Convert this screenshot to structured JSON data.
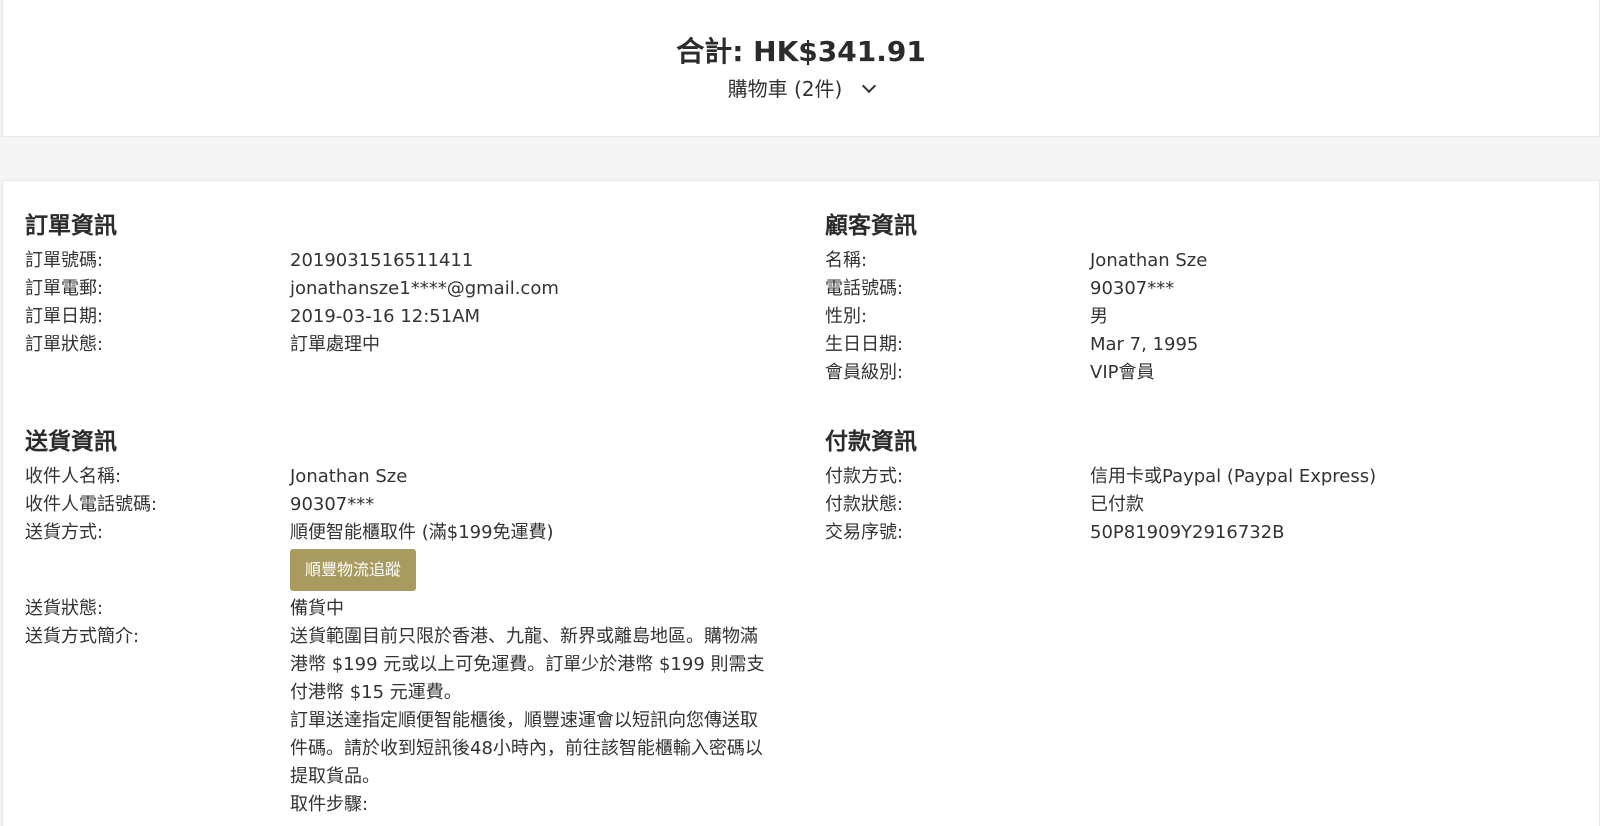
{
  "summary": {
    "total_text": "合計: HK$341.91",
    "cart_label": "購物車 (2件)",
    "toggle_icon": "chevron-down-icon"
  },
  "order_info": {
    "title": "訂單資訊",
    "rows": [
      {
        "label": "訂單號碼:",
        "value": "2019031516511411"
      },
      {
        "label": "訂單電郵:",
        "value": "jonathansze1****@gmail.com"
      },
      {
        "label": "訂單日期:",
        "value": "2019-03-16 12:51AM"
      },
      {
        "label": "訂單狀態:",
        "value": "訂單處理中"
      }
    ]
  },
  "customer_info": {
    "title": "顧客資訊",
    "rows": [
      {
        "label": "名稱:",
        "value": "Jonathan Sze"
      },
      {
        "label": "電話號碼:",
        "value": "90307***"
      },
      {
        "label": "性別:",
        "value": "男"
      },
      {
        "label": "生日日期:",
        "value": "Mar 7, 1995"
      },
      {
        "label": "會員級別:",
        "value": "VIP會員"
      }
    ]
  },
  "shipping_info": {
    "title": "送貨資訊",
    "recipient_name_label": "收件人名稱:",
    "recipient_name": "Jonathan Sze",
    "recipient_phone_label": "收件人電話號碼:",
    "recipient_phone": "90307***",
    "method_label": "送貨方式:",
    "method": "順便智能櫃取件 (滿$199免運費)",
    "track_button": "順豐物流追蹤",
    "status_label": "送貨狀態:",
    "status": "備貨中",
    "desc_label": "送貨方式簡介:",
    "desc_paragraphs": [
      "送貨範圍目前只限於香港、九龍、新界或離島地區。購物滿港幣 $199 元或以上可免運費。訂單少於港幣 $199 則需支付港幣 $15 元運費。",
      "訂單送達指定順便智能櫃後，順豐速運會以短訊向您傳送取件碼。請於收到短訊後48小時內，前往該智能櫃輸入密碼以提取貨品。",
      "取件步驟:"
    ]
  },
  "payment_info": {
    "title": "付款資訊",
    "rows": [
      {
        "label": "付款方式:",
        "value": "信用卡或Paypal (Paypal Express)"
      },
      {
        "label": "付款狀態:",
        "value": "已付款"
      },
      {
        "label": "交易序號:",
        "value": "50P81909Y2916732B"
      }
    ]
  },
  "colors": {
    "button_bg": "#a99b5f",
    "page_bg": "#f4f4f4"
  }
}
